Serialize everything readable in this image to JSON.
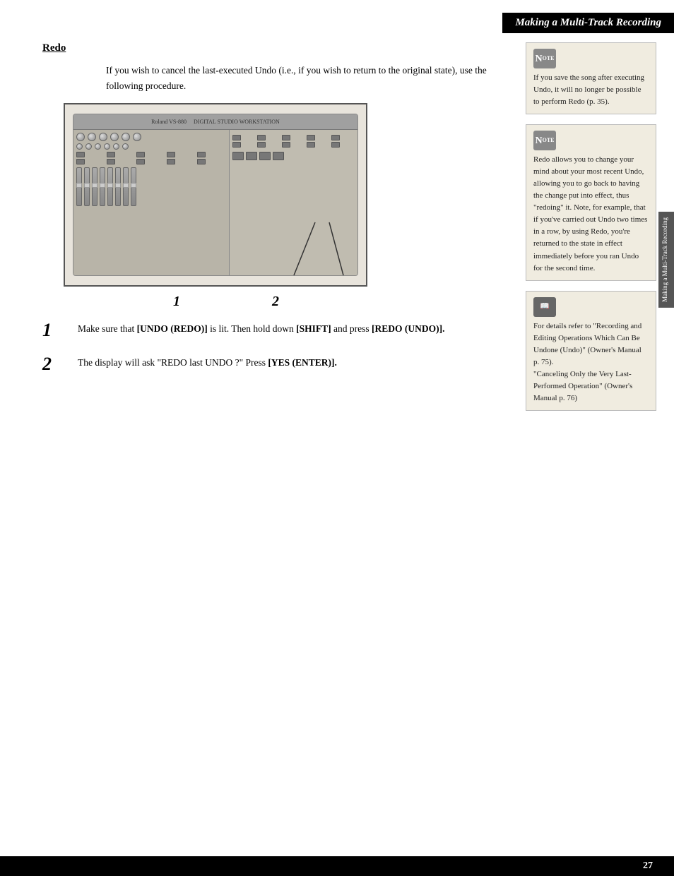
{
  "header": {
    "title": "Making a Multi-Track Recording"
  },
  "sidebar_tab": {
    "label": "Making a Multi-Track Recording"
  },
  "section": {
    "heading": "Redo",
    "intro": "If you wish to cancel the last-executed Undo (i.e., if you wish to return to the original state), use the following procedure."
  },
  "steps": [
    {
      "number": "1",
      "text_parts": [
        {
          "text": "Make sure that ",
          "bold": false
        },
        {
          "text": "[UNDO (REDO)]",
          "bold": true
        },
        {
          "text": " is lit. Then hold down ",
          "bold": false
        },
        {
          "text": "[SHIFT]",
          "bold": true
        },
        {
          "text": " and press ",
          "bold": false
        },
        {
          "text": "[REDO (UNDO)].",
          "bold": true
        }
      ]
    },
    {
      "number": "2",
      "text_parts": [
        {
          "text": "The display will ask \"REDO last UNDO ?\" Press ",
          "bold": false
        },
        {
          "text": "[YES (ENTER)].",
          "bold": true
        }
      ]
    }
  ],
  "step_numbers_display": [
    "1",
    "2"
  ],
  "right_notes": [
    {
      "type": "note",
      "text": "If you save the song after executing Undo, it will no longer be possible to perform Redo (p. 35)."
    },
    {
      "type": "note",
      "text": "Redo allows you to change your mind about your most recent Undo, allowing you to go back to having the change put into effect, thus \"redoing\" it. Note, for example, that if you've carried out Undo two times in a row, by using Redo, you're returned to the state in effect immediately before you ran Undo for the second time."
    },
    {
      "type": "ref",
      "text": "For details refer to \"Recording and Editing Operations Which Can Be Undone (Undo)\" (Owner's Manual p. 75).\n\"Canceling Only the Very Last-Performed Operation\" (Owner's Manual p. 76)"
    }
  ],
  "page_number": "27"
}
